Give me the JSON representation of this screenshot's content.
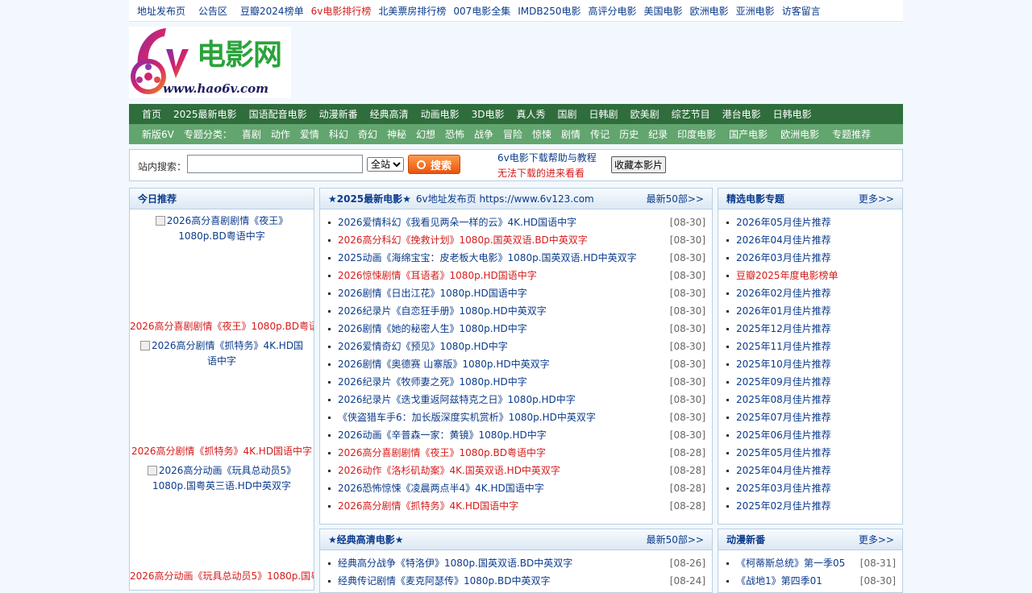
{
  "toplinks": [
    {
      "label": "地址发布页",
      "red": false,
      "gap": true
    },
    {
      "label": "公告区",
      "red": false,
      "gap": true
    },
    {
      "label": "豆瓣2024榜单",
      "red": false,
      "gap": false
    },
    {
      "label": "6v电影排行榜",
      "red": true,
      "gap": false
    },
    {
      "label": "北美票房排行榜",
      "red": false,
      "gap": false
    },
    {
      "label": "007电影全集",
      "red": false,
      "gap": false
    },
    {
      "label": "IMDB250电影",
      "red": false,
      "gap": false
    },
    {
      "label": "高评分电影",
      "red": false,
      "gap": false
    },
    {
      "label": "美国电影",
      "red": false,
      "gap": false
    },
    {
      "label": "欧洲电影",
      "red": false,
      "gap": false
    },
    {
      "label": "亚洲电影",
      "red": false,
      "gap": false
    },
    {
      "label": "访客留言",
      "red": false,
      "gap": false
    }
  ],
  "logo": {
    "title": "电影网",
    "mark": "6v",
    "url": "www.hao6v.com"
  },
  "nav1": [
    "首页",
    "2025最新电影",
    "国语配音电影",
    "动漫新番",
    "经典高清",
    "动画电影",
    "3D电影",
    "真人秀",
    "国剧",
    "日韩剧",
    "欧美剧",
    "综艺节目",
    "港台电影",
    "日韩电影"
  ],
  "nav2": {
    "items": [
      {
        "label": "新版6V",
        "wide": false
      },
      {
        "label": "专题分类：",
        "wide": false
      },
      {
        "label": "喜剧",
        "wide": false
      },
      {
        "label": "动作",
        "wide": false
      },
      {
        "label": "爱情",
        "wide": false
      },
      {
        "label": "科幻",
        "wide": false
      },
      {
        "label": "奇幻",
        "wide": false
      },
      {
        "label": "神秘",
        "wide": false
      },
      {
        "label": "幻想",
        "wide": false
      },
      {
        "label": "恐怖",
        "wide": false
      },
      {
        "label": "战争",
        "wide": false
      },
      {
        "label": "冒险",
        "wide": false
      },
      {
        "label": "惊悚",
        "wide": false
      },
      {
        "label": "剧情",
        "wide": false
      },
      {
        "label": "传记",
        "wide": false
      },
      {
        "label": "历史",
        "wide": false
      },
      {
        "label": "纪录",
        "wide": false
      },
      {
        "label": "印度电影",
        "wide": true
      },
      {
        "label": "国产电影",
        "wide": true
      },
      {
        "label": "欧洲电影",
        "wide": true
      },
      {
        "label": "专题推荐",
        "wide": false
      }
    ]
  },
  "search": {
    "label": "站内搜索：",
    "value": "",
    "scope": "全站",
    "button": "搜索",
    "help1": "6v电影下载帮助与教程",
    "help2": "无法下载的进来看看",
    "fav": "收藏本影片"
  },
  "today": {
    "title": "今日推荐",
    "items": [
      {
        "alt": "2026高分喜剧剧情《夜王》1080p.BD粤语中字",
        "cap": "2026高分喜剧剧情《夜王》1080p.BD粤语中字"
      },
      {
        "alt": "2026高分剧情《抓特务》4K.HD国语中字",
        "cap": "2026高分剧情《抓特务》4K.HD国语中字"
      },
      {
        "alt": "2026高分动画《玩具总动员5》1080p.国粤英三语.HD中英双字",
        "cap": "2026高分动画《玩具总动员5》1080p.国粤英三语.HD中英双字"
      }
    ]
  },
  "latest": {
    "title": "★2025最新电影★",
    "sub": "6v地址发布页 https://www.6v123.com",
    "more": "最新50部>>",
    "items": [
      {
        "t": "2026爱情科幻《我看见两朵一样的云》4K.HD国语中字",
        "d": "[08-30]",
        "red": false
      },
      {
        "t": "2026高分科幻《挽救计划》1080p.国英双语.BD中英双字",
        "d": "[08-30]",
        "red": true
      },
      {
        "t": "2025动画《海绵宝宝：皮老板大电影》1080p.国英双语.HD中英双字",
        "d": "[08-30]",
        "red": false
      },
      {
        "t": "2026惊悚剧情《耳语者》1080p.HD国语中字",
        "d": "[08-30]",
        "red": true
      },
      {
        "t": "2026剧情《日出江花》1080p.HD国语中字",
        "d": "[08-30]",
        "red": false
      },
      {
        "t": "2026纪录片《自恋狂手册》1080p.HD中英双字",
        "d": "[08-30]",
        "red": false
      },
      {
        "t": "2026剧情《她的秘密人生》1080p.HD中字",
        "d": "[08-30]",
        "red": false
      },
      {
        "t": "2026爱情奇幻《预见》1080p.HD中字",
        "d": "[08-30]",
        "red": false
      },
      {
        "t": "2026剧情《奥德赛 山寨版》1080p.HD中英双字",
        "d": "[08-30]",
        "red": false
      },
      {
        "t": "2026纪录片《牧师妻之死》1080p.HD中字",
        "d": "[08-30]",
        "red": false
      },
      {
        "t": "2026纪录片《迭戈重返阿兹特克之日》1080p.HD中字",
        "d": "[08-30]",
        "red": false
      },
      {
        "t": "《侠盗猎车手6：加长版深度实机赏析》1080p.HD中英双字",
        "d": "[08-30]",
        "red": false
      },
      {
        "t": "2026动画《辛普森一家：黄镜》1080p.HD中字",
        "d": "[08-30]",
        "red": false
      },
      {
        "t": "2026高分喜剧剧情《夜王》1080p.BD粤语中字",
        "d": "[08-28]",
        "red": true
      },
      {
        "t": "2026动作《洛杉矶劫案》4K.国英双语.HD中英双字",
        "d": "[08-28]",
        "red": true
      },
      {
        "t": "2026恐怖惊悚《凌晨两点半4》4K.HD国语中字",
        "d": "[08-28]",
        "red": false
      },
      {
        "t": "2026高分剧情《抓特务》4K.HD国语中字",
        "d": "[08-28]",
        "red": true
      }
    ]
  },
  "classic": {
    "title": "★经典高清电影★",
    "more": "最新50部>>",
    "items": [
      {
        "t": "经典高分战争《特洛伊》1080p.国英双语.BD中英双字",
        "d": "[08-26]",
        "red": false
      },
      {
        "t": "经典传记剧情《麦克阿瑟传》1080p.BD中英双字",
        "d": "[08-24]",
        "red": false
      }
    ]
  },
  "topics": {
    "title": "精选电影专题",
    "more": "更多>>",
    "items": [
      {
        "t": "2026年05月佳片推荐",
        "red": false
      },
      {
        "t": "2026年04月佳片推荐",
        "red": false
      },
      {
        "t": "2026年03月佳片推荐",
        "red": false
      },
      {
        "t": "豆瓣2025年度电影榜单",
        "red": true
      },
      {
        "t": "2026年02月佳片推荐",
        "red": false
      },
      {
        "t": "2026年01月佳片推荐",
        "red": false
      },
      {
        "t": "2025年12月佳片推荐",
        "red": false
      },
      {
        "t": "2025年11月佳片推荐",
        "red": false
      },
      {
        "t": "2025年10月佳片推荐",
        "red": false
      },
      {
        "t": "2025年09月佳片推荐",
        "red": false
      },
      {
        "t": "2025年08月佳片推荐",
        "red": false
      },
      {
        "t": "2025年07月佳片推荐",
        "red": false
      },
      {
        "t": "2025年06月佳片推荐",
        "red": false
      },
      {
        "t": "2025年05月佳片推荐",
        "red": false
      },
      {
        "t": "2025年04月佳片推荐",
        "red": false
      },
      {
        "t": "2025年03月佳片推荐",
        "red": false
      },
      {
        "t": "2025年02月佳片推荐",
        "red": false
      }
    ]
  },
  "anime": {
    "title": "动漫新番",
    "more": "更多>>",
    "items": [
      {
        "t": "《柯蒂斯总统》第一季05",
        "d": "[08-31]",
        "red": false
      },
      {
        "t": "《战地1》第四季01",
        "d": "[08-30]",
        "red": false
      }
    ]
  }
}
